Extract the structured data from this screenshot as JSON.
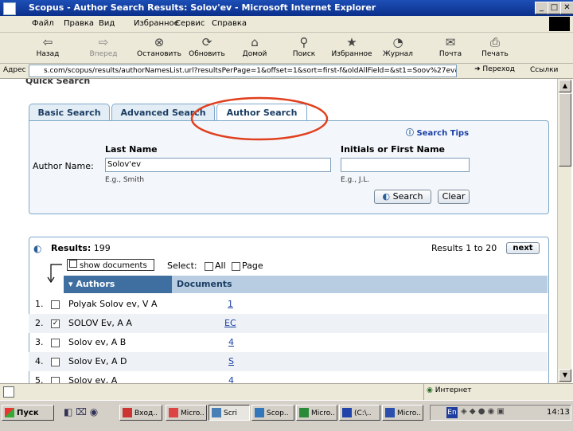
{
  "window": {
    "title": "Scopus - Author Search Results: Solov'ev - Microsoft Internet Explorer"
  },
  "menu": [
    "Файл",
    "Правка",
    "Вид",
    "Избранное",
    "Сервис",
    "Справка"
  ],
  "toolbar": {
    "back": "Назад",
    "forward": "Вперед",
    "stop": "Остановить",
    "refresh": "Обновить",
    "home": "Домой",
    "search": "Поиск",
    "favorites": "Избранное",
    "history": "Журнал",
    "mail": "Почта",
    "print": "Печать"
  },
  "address": {
    "label": "Адрес",
    "url": "s.com/scopus/results/authorNamesList.url?resultsPerPage=1&offset=1&sort=first-f&oldAllField=&st1=Soov%27ev&s2=",
    "go": "Переход",
    "links": "Ссылки"
  },
  "top_cut": "Quick Search",
  "tabs": {
    "basic": "Basic Search",
    "advanced": "Advanced Search",
    "author": "Author Search"
  },
  "search": {
    "tips": "Search Tips",
    "last_name_label": "Last Name",
    "first_name_label": "Initials or First Name",
    "author_name_label": "Author Name:",
    "last_name_value": "Solov'ev",
    "first_name_value": "",
    "last_hint": "E.g., Smith",
    "first_hint": "E.g., J.L.",
    "search_button": "Search",
    "clear_button": "Clear"
  },
  "results": {
    "label": "Results:",
    "count": "199",
    "range": "Results 1 to 20",
    "next": "next",
    "show_documents": "show documents",
    "select_label": "Select:",
    "all": "All",
    "page": "Page",
    "col_authors": "Authors",
    "col_documents": "Documents",
    "rows": [
      {
        "num": "1.",
        "name": "Polyak Solov ev, V A",
        "docs": "1",
        "checked": false
      },
      {
        "num": "2.",
        "name": "SOLOV Ev, A A",
        "docs": "EC",
        "checked": true
      },
      {
        "num": "3.",
        "name": "Solov ev, A B",
        "docs": "4",
        "checked": false
      },
      {
        "num": "4.",
        "name": "Solov Ev, A D",
        "docs": "S",
        "checked": false
      },
      {
        "num": "5.",
        "name": "Solov ev, A",
        "docs": "4",
        "checked": false
      }
    ]
  },
  "status": {
    "zone": "Интернет"
  },
  "taskbar": {
    "start": "Пуск",
    "items": [
      "Вход..",
      "Micro..",
      "Scri",
      "Scop..",
      "Micro..",
      "(C:\\..",
      "Micro.."
    ],
    "lang": "En",
    "clock": "14:13"
  },
  "colors": {
    "accent": "#3a6fa3",
    "annotation": "#e0401e",
    "header": "#4a7fb5"
  }
}
